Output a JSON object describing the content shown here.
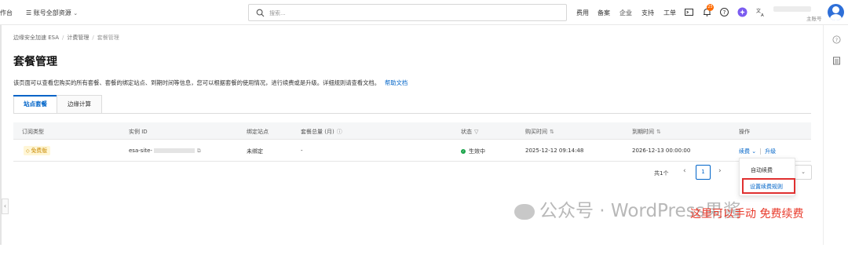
{
  "topbar": {
    "workbench": "作台",
    "resource_group": "账号全部资源",
    "search_placeholder": "搜索...",
    "nav": [
      "费用",
      "备案",
      "企业",
      "支持",
      "工单"
    ],
    "bell_badge": "25",
    "account_type": "主账号"
  },
  "breadcrumb": [
    "边缘安全加速 ESA",
    "计费管理",
    "套餐管理"
  ],
  "page_title": "套餐管理",
  "description": "该页面可以查看您购买的所有套餐、套餐的绑定站点、到期时间等信息，您可以根据套餐的使用情况，进行续费或是升级。详细规则请查看文档。",
  "help_link": "帮助文档",
  "tabs": [
    {
      "label": "站点套餐",
      "active": true
    },
    {
      "label": "边缘计算",
      "active": false
    }
  ],
  "table": {
    "columns": [
      "订阅类型",
      "实例 ID",
      "绑定站点",
      "套餐总量 (月)",
      "状态",
      "购买时间",
      "到期时间",
      "操作"
    ],
    "rows": [
      {
        "plan": "免费版",
        "instance_id": "esa-site-",
        "site": "未绑定",
        "quota": "-",
        "status": "生效中",
        "purchase_time": "2025-12-12 09:14:48",
        "expire_time": "2026-12-13 00:00:00",
        "action_renew": "续费",
        "action_upgrade": "升级"
      }
    ]
  },
  "pagination": {
    "total": "共1个",
    "current_page": "1"
  },
  "renew_menu": {
    "auto_renew": "自动续费",
    "set_rules": "设置续费规则"
  },
  "watermark": "公众号 · WordPress果酱",
  "annotation": "这里可以手动 免费续费",
  "colors": {
    "primary": "#0064c8",
    "success": "#1aa44a",
    "badge_orange": "#ff6a00",
    "highlight_red": "#e03030"
  }
}
